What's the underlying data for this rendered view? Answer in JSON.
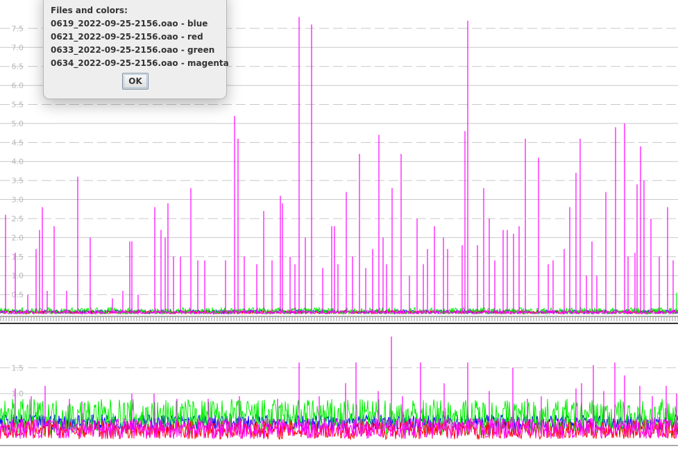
{
  "chart_data": [
    {
      "type": "line",
      "title": "",
      "xlabel": "",
      "ylabel": "",
      "ylim": [
        0,
        8.1
      ],
      "yticks": [
        "0.5",
        "1.0",
        "1.5",
        "2.0",
        "2.5",
        "3.0",
        "3.5",
        "4.0",
        "4.5",
        "5.0",
        "5.5",
        "6.0",
        "6.5",
        "7.0",
        "7.5"
      ],
      "grid": true,
      "series": [
        {
          "name": "blue",
          "color": "#0000ff",
          "base": 0.05,
          "noise": 0.05,
          "spikes": []
        },
        {
          "name": "red",
          "color": "#ff0000",
          "base": 0.04,
          "noise": 0.04,
          "spikes": []
        },
        {
          "name": "green",
          "color": "#00ee00",
          "base": 0.06,
          "noise": 0.1,
          "spikes": [
            [
              975,
              0.55
            ]
          ]
        },
        {
          "name": "magenta",
          "color": "#ff00ff",
          "base": 0.03,
          "noise": 0.05,
          "spikes": [
            [
              8,
              2.6
            ],
            [
              22,
              1.6
            ],
            [
              40,
              0.5
            ],
            [
              52,
              1.7
            ],
            [
              57,
              2.2
            ],
            [
              61,
              2.8
            ],
            [
              68,
              0.6
            ],
            [
              78,
              2.3
            ],
            [
              96,
              0.6
            ],
            [
              112,
              3.6
            ],
            [
              130,
              2.0
            ],
            [
              162,
              0.4
            ],
            [
              177,
              0.6
            ],
            [
              187,
              1.9
            ],
            [
              190,
              1.9
            ],
            [
              199,
              0.5
            ],
            [
              223,
              2.8
            ],
            [
              232,
              2.2
            ],
            [
              238,
              2.0
            ],
            [
              242,
              2.9
            ],
            [
              250,
              1.5
            ],
            [
              260,
              1.5
            ],
            [
              275,
              3.3
            ],
            [
              285,
              1.4
            ],
            [
              295,
              1.4
            ],
            [
              325,
              1.4
            ],
            [
              338,
              5.2
            ],
            [
              343,
              4.6
            ],
            [
              352,
              1.5
            ],
            [
              370,
              1.3
            ],
            [
              380,
              2.7
            ],
            [
              392,
              1.4
            ],
            [
              404,
              3.1
            ],
            [
              407,
              2.9
            ],
            [
              418,
              1.5
            ],
            [
              425,
              1.3
            ],
            [
              431,
              7.8
            ],
            [
              440,
              2.0
            ],
            [
              449,
              7.6
            ],
            [
              465,
              1.2
            ],
            [
              478,
              2.3
            ],
            [
              482,
              2.3
            ],
            [
              487,
              1.3
            ],
            [
              499,
              3.2
            ],
            [
              508,
              1.5
            ],
            [
              518,
              4.2
            ],
            [
              527,
              1.2
            ],
            [
              537,
              1.7
            ],
            [
              546,
              4.7
            ],
            [
              552,
              2.0
            ],
            [
              557,
              1.3
            ],
            [
              565,
              3.3
            ],
            [
              578,
              4.2
            ],
            [
              590,
              1.0
            ],
            [
              601,
              2.5
            ],
            [
              610,
              1.3
            ],
            [
              616,
              1.7
            ],
            [
              626,
              2.3
            ],
            [
              639,
              2.0
            ],
            [
              645,
              1.7
            ],
            [
              666,
              1.8
            ],
            [
              670,
              4.8
            ],
            [
              674,
              7.7
            ],
            [
              688,
              1.8
            ],
            [
              697,
              3.3
            ],
            [
              705,
              2.5
            ],
            [
              713,
              1.4
            ],
            [
              725,
              2.2
            ],
            [
              731,
              2.2
            ],
            [
              740,
              2.1
            ],
            [
              748,
              2.3
            ],
            [
              757,
              4.6
            ],
            [
              776,
              4.1
            ],
            [
              790,
              1.3
            ],
            [
              797,
              1.4
            ],
            [
              813,
              1.7
            ],
            [
              821,
              2.8
            ],
            [
              830,
              3.7
            ],
            [
              836,
              4.6
            ],
            [
              845,
              1.0
            ],
            [
              853,
              1.9
            ],
            [
              860,
              1.0
            ],
            [
              873,
              3.2
            ],
            [
              887,
              4.9
            ],
            [
              900,
              5.0
            ],
            [
              905,
              1.5
            ],
            [
              915,
              1.6
            ],
            [
              918,
              3.4
            ],
            [
              923,
              4.4
            ],
            [
              928,
              3.5
            ],
            [
              938,
              2.5
            ],
            [
              950,
              1.5
            ],
            [
              962,
              2.8
            ],
            [
              970,
              1.4
            ]
          ]
        }
      ]
    },
    {
      "type": "line",
      "title": "",
      "xlabel": "",
      "ylabel": "",
      "ylim": [
        0,
        2.3
      ],
      "yticks": [
        "0.5",
        "1.0",
        "1.5"
      ],
      "grid": true,
      "series": [
        {
          "name": "blue",
          "color": "#0000ff",
          "base": 0.45,
          "noise": 0.15,
          "spikes": []
        },
        {
          "name": "green",
          "color": "#00ee00",
          "base": 0.55,
          "noise": 0.35,
          "spikes": [
            [
              975,
              0.9
            ]
          ]
        },
        {
          "name": "red",
          "color": "#ff0000",
          "base": 0.3,
          "noise": 0.18,
          "spikes": []
        },
        {
          "name": "magenta",
          "color": "#ff00ff",
          "base": 0.33,
          "noise": 0.2,
          "spikes": [
            [
              22,
              1.1
            ],
            [
              45,
              0.95
            ],
            [
              65,
              1.15
            ],
            [
              100,
              0.9
            ],
            [
              118,
              0.85
            ],
            [
              190,
              1.0
            ],
            [
              222,
              1.0
            ],
            [
              255,
              0.9
            ],
            [
              300,
              0.9
            ],
            [
              345,
              0.95
            ],
            [
              400,
              0.9
            ],
            [
              431,
              1.6
            ],
            [
              460,
              0.95
            ],
            [
              498,
              1.2
            ],
            [
              513,
              1.6
            ],
            [
              545,
              1.05
            ],
            [
              564,
              2.1
            ],
            [
              580,
              0.95
            ],
            [
              606,
              1.6
            ],
            [
              640,
              1.2
            ],
            [
              674,
              1.6
            ],
            [
              705,
              1.05
            ],
            [
              739,
              1.5
            ],
            [
              760,
              0.9
            ],
            [
              780,
              0.95
            ],
            [
              830,
              1.1
            ],
            [
              838,
              1.2
            ],
            [
              855,
              1.55
            ],
            [
              870,
              1.05
            ],
            [
              886,
              1.6
            ],
            [
              900,
              1.35
            ],
            [
              922,
              1.15
            ],
            [
              940,
              0.95
            ],
            [
              960,
              1.15
            ],
            [
              975,
              1.0
            ]
          ]
        }
      ]
    }
  ],
  "dialog": {
    "heading": "Files and colors:",
    "lines": [
      "0619_2022-09-25-2156.oao - blue",
      "0621_2022-09-25-2156.oao - red",
      "0633_2022-09-25-2156.oao - green",
      "0634_2022-09-25-2156.oao - magenta"
    ],
    "ok_label": "OK"
  }
}
